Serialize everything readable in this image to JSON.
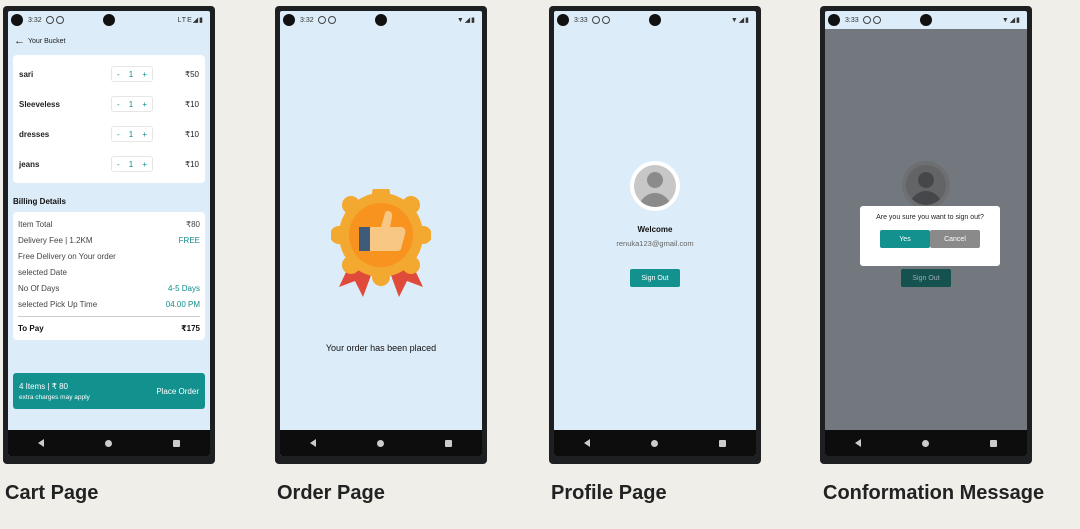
{
  "screens": {
    "cart": {
      "caption": "Cart Page",
      "status_time": "3:32",
      "status_right": "LTE◢▮",
      "header_title": "Your Bucket",
      "items": [
        {
          "name": "sari",
          "qty": "1",
          "price": "₹50"
        },
        {
          "name": "Sleeveless",
          "qty": "1",
          "price": "₹10"
        },
        {
          "name": "dresses",
          "qty": "1",
          "price": "₹10"
        },
        {
          "name": "jeans",
          "qty": "1",
          "price": "₹10"
        }
      ],
      "stepper_minus": "-",
      "stepper_plus": "+",
      "billing_title": "Billing Details",
      "bill": {
        "item_total_label": "Item Total",
        "item_total_value": "₹80",
        "delivery_label": "Delivery Fee | 1.2KM",
        "delivery_value": "FREE",
        "free_delivery_note": "Free Delivery on Your order",
        "selected_date_label": "selected Date",
        "days_label": "No Of Days",
        "days_value": "4-5 Days",
        "pickup_label": "selected Pick Up Time",
        "pickup_value": "04.00 PM",
        "to_pay_label": "To Pay",
        "to_pay_value": "₹175"
      },
      "order_bar": {
        "summary": "4 Items | ₹ 80",
        "note": "extra charges may apply",
        "button": "Place Order"
      }
    },
    "order": {
      "caption": "Order Page",
      "status_time": "3:32",
      "status_right": "▼◢▮",
      "message": "Your order has been placed"
    },
    "profile": {
      "caption": "Profile Page",
      "status_time": "3:33",
      "status_right": "▼◢▮",
      "welcome": "Welcome",
      "email": "renuka123@gmail.com",
      "signout": "Sign Out"
    },
    "confirm": {
      "caption": "Conformation Message",
      "status_time": "3:33",
      "status_right": "▼◢▮",
      "question": "Are you sure you want to sign out?",
      "yes": "Yes",
      "cancel": "Cancel",
      "signout": "Sign Out"
    }
  },
  "colors": {
    "accent": "#13918f",
    "screen_bg": "#dcecf8",
    "page_bg": "#efeee9"
  }
}
